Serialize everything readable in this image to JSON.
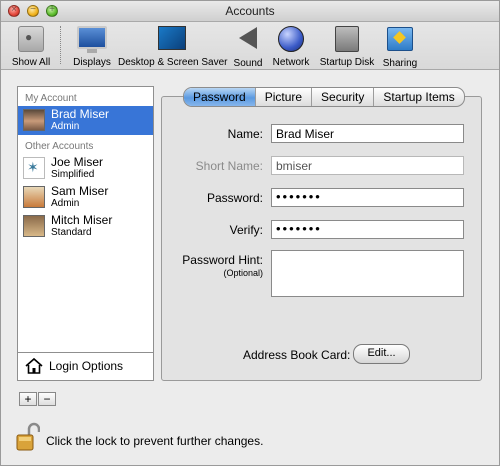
{
  "window": {
    "title": "Accounts"
  },
  "toolbar": {
    "items": [
      {
        "label": "Show All",
        "icon": "apple-icon"
      },
      {
        "label": "Displays",
        "icon": "display-icon"
      },
      {
        "label": "Desktop & Screen Saver",
        "icon": "desktop-icon"
      },
      {
        "label": "Sound",
        "icon": "speaker-icon"
      },
      {
        "label": "Network",
        "icon": "globe-icon"
      },
      {
        "label": "Startup Disk",
        "icon": "hard-disk-icon"
      },
      {
        "label": "Sharing",
        "icon": "folder-icon"
      }
    ]
  },
  "sidebar": {
    "my_account_header": "My Account",
    "other_accounts_header": "Other Accounts",
    "accounts": [
      {
        "name": "Brad Miser",
        "role": "Admin",
        "selected": true
      },
      {
        "name": "Joe Miser",
        "role": "Simplified",
        "selected": false
      },
      {
        "name": "Sam Miser",
        "role": "Admin",
        "selected": false
      },
      {
        "name": "Mitch Miser",
        "role": "Standard",
        "selected": false
      }
    ],
    "login_options": "Login Options",
    "add_label": "+",
    "remove_label": "−"
  },
  "tabs": [
    {
      "label": "Password",
      "active": true
    },
    {
      "label": "Picture",
      "active": false
    },
    {
      "label": "Security",
      "active": false
    },
    {
      "label": "Startup Items",
      "active": false
    }
  ],
  "form": {
    "name_label": "Name:",
    "name_value": "Brad Miser",
    "short_name_label": "Short Name:",
    "short_name_value": "bmiser",
    "password_label": "Password:",
    "password_value": "•••••••",
    "verify_label": "Verify:",
    "verify_value": "•••••••",
    "hint_label": "Password Hint:",
    "hint_sub": "(Optional)",
    "hint_value": "",
    "address_book_label": "Address Book Card:",
    "edit_button": "Edit..."
  },
  "footer": {
    "lock_text": "Click the lock to prevent further changes."
  },
  "colors": {
    "selection": "#3875d7",
    "active_tab": "#5b9ae0"
  }
}
